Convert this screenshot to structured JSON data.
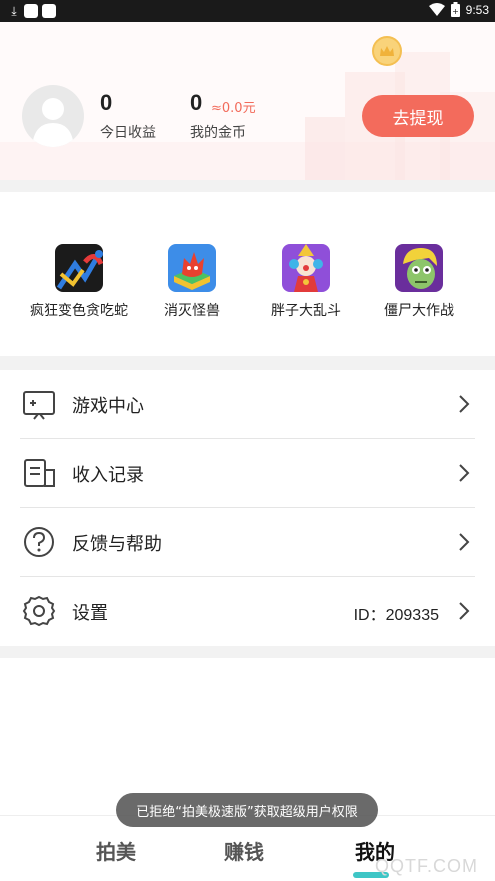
{
  "status_bar": {
    "time": "9:53",
    "download_glyph": "⤓",
    "icons": [
      "download-icon",
      "app-icon",
      "app-icon",
      "wifi-icon",
      "battery-icon"
    ]
  },
  "header": {
    "today_earnings_value": "0",
    "today_earnings_label": "今日收益",
    "my_coins_value": "0",
    "my_coins_approx": "≈0.0元",
    "my_coins_label": "我的金币",
    "withdraw_label": "去提现",
    "accent_color": "#f36b5c"
  },
  "games": [
    {
      "label": "疯狂变色贪吃蛇",
      "icon": "snake-game-icon"
    },
    {
      "label": "消灭怪兽",
      "icon": "monster-game-icon"
    },
    {
      "label": "胖子大乱斗",
      "icon": "clown-game-icon"
    },
    {
      "label": "僵尸大作战",
      "icon": "zombie-game-icon"
    }
  ],
  "menu": {
    "game_center": "游戏中心",
    "income_records": "收入记录",
    "feedback_help": "反馈与帮助",
    "settings": "设置",
    "user_id": "ID：209335"
  },
  "toast": "已拒绝“拍美极速版”获取超级用户权限",
  "bottom_nav": {
    "tab1": "拍美",
    "tab2": "赚钱",
    "tab3": "我的"
  },
  "watermark": "QQTF.COM"
}
